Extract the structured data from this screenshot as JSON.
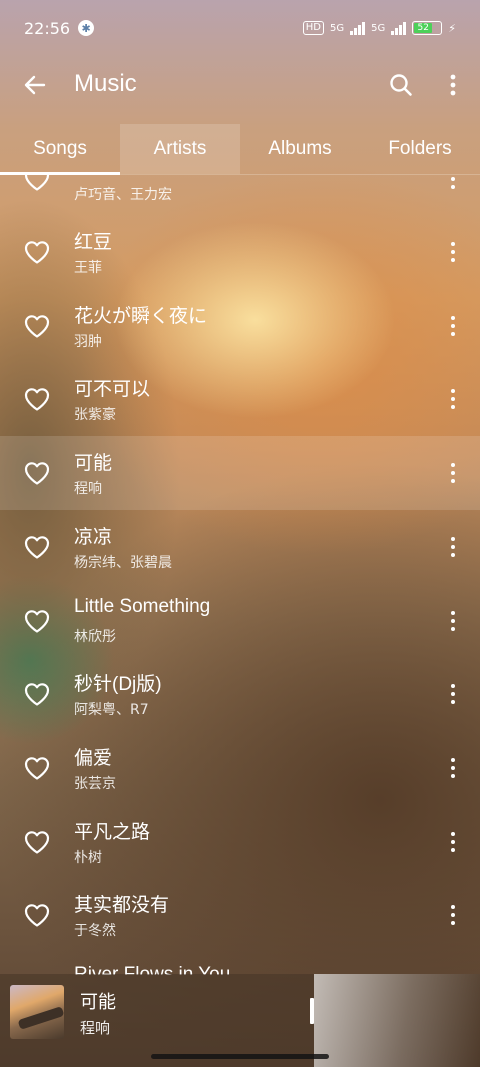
{
  "status_bar": {
    "time": "22:56",
    "settings_glyph": "✱",
    "hd_label": "HD",
    "net1": "5G",
    "net2": "5G",
    "battery": "52",
    "battery_level": 0.52
  },
  "app_bar": {
    "title": "Music",
    "back_icon": "back-arrow-icon",
    "search_icon": "search-icon",
    "more_icon": "more-vertical-icon"
  },
  "tabs": [
    {
      "label": "Songs",
      "active": true
    },
    {
      "label": "Artists",
      "active": false
    },
    {
      "label": "Albums",
      "active": false
    },
    {
      "label": "Folders",
      "active": false
    }
  ],
  "songs": [
    {
      "title": "",
      "artist": "卢巧音、王力宏"
    },
    {
      "title": "红豆",
      "artist": "王菲"
    },
    {
      "title": "花火が瞬く夜に",
      "artist": "羽肿"
    },
    {
      "title": "可不可以",
      "artist": "张紫豪"
    },
    {
      "title": "可能",
      "artist": "程响"
    },
    {
      "title": "凉凉",
      "artist": "杨宗纬、张碧晨"
    },
    {
      "title": "Little Something",
      "artist": "林欣彤"
    },
    {
      "title": "秒针(Dj版)",
      "artist": "阿梨粤、R7"
    },
    {
      "title": "偏爱",
      "artist": "张芸京"
    },
    {
      "title": "平凡之路",
      "artist": "朴树"
    },
    {
      "title": "其实都没有",
      "artist": "于冬然"
    },
    {
      "title": "River Flows in You",
      "artist": ""
    }
  ],
  "now_playing": {
    "title": "可能",
    "artist": "程响"
  }
}
